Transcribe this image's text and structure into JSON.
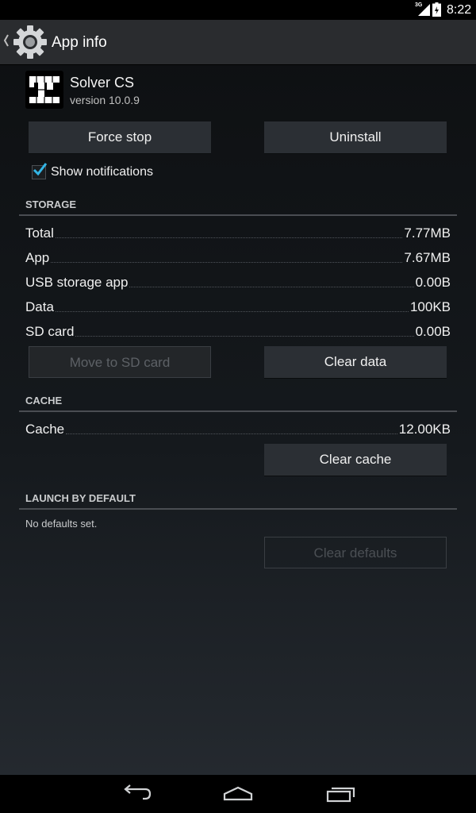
{
  "status_bar": {
    "network": "3G",
    "time": "8:22",
    "icons": [
      "signal-icon",
      "battery-icon"
    ]
  },
  "action_bar": {
    "title": "App info",
    "icons": [
      "back-caret-icon",
      "settings-gear-icon"
    ]
  },
  "app": {
    "name": "Solver CS",
    "version": "version 10.0.9",
    "icon": "solver-cs-app-icon"
  },
  "buttons": {
    "force_stop": "Force stop",
    "uninstall": "Uninstall",
    "move_to_sd": "Move to SD card",
    "clear_data": "Clear data",
    "clear_cache": "Clear cache",
    "clear_defaults": "Clear defaults"
  },
  "notifications": {
    "label": "Show notifications",
    "checked": true
  },
  "storage": {
    "header": "STORAGE",
    "rows": [
      {
        "label": "Total",
        "value": "7.77MB"
      },
      {
        "label": "App",
        "value": "7.67MB"
      },
      {
        "label": "USB storage app",
        "value": "0.00B"
      },
      {
        "label": "Data",
        "value": "100KB"
      },
      {
        "label": "SD card",
        "value": "0.00B"
      }
    ]
  },
  "cache": {
    "header": "CACHE",
    "rows": [
      {
        "label": "Cache",
        "value": "12.00KB"
      }
    ]
  },
  "launch": {
    "header": "LAUNCH BY DEFAULT",
    "text": "No defaults set."
  },
  "nav_bar": {
    "icons": [
      "back-icon",
      "home-icon",
      "recents-icon"
    ]
  },
  "colors": {
    "accent": "#33b5e5",
    "background": "#15191d",
    "button": "#2b2f34"
  }
}
